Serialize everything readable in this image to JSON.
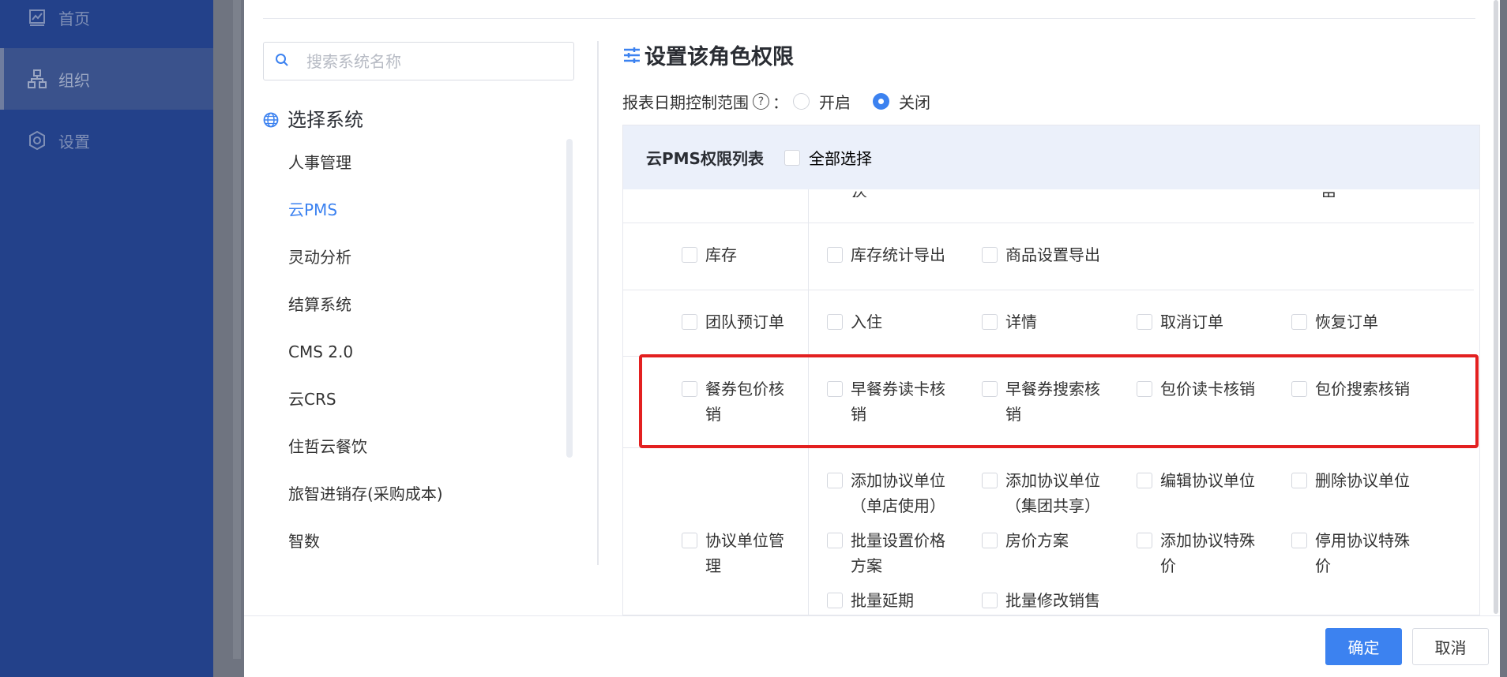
{
  "sidebar": {
    "items": [
      {
        "label": "首页",
        "icon": "chart-icon"
      },
      {
        "label": "组织",
        "icon": "org-icon"
      },
      {
        "label": "设置",
        "icon": "gear-icon"
      }
    ]
  },
  "search": {
    "placeholder": "搜索系统名称"
  },
  "systems": {
    "title": "选择系统",
    "items": [
      "人事管理",
      "云PMS",
      "灵动分析",
      "结算系统",
      "CMS 2.0",
      "云CRS",
      "住哲云餐饮",
      "旅智进销存(采购成本)",
      "智数"
    ],
    "selected": "云PMS"
  },
  "permissions": {
    "title": "设置该角色权限",
    "date_control_label": "报表日期控制范围",
    "date_control_colon": "：",
    "date_control_help": "?",
    "options": [
      "开启",
      "关闭"
    ],
    "selected_option": "关闭",
    "table_title": "云PMS权限列表",
    "select_all": "全部选择",
    "cut_top": [
      "价",
      "用"
    ],
    "rows": [
      {
        "module": "库存",
        "perms": [
          "库存统计导出",
          "商品设置导出"
        ]
      },
      {
        "module": "团队预订单",
        "perms": [
          "入住",
          "详情",
          "取消订单",
          "恢复订单"
        ]
      },
      {
        "module": "餐券包价核销",
        "perms": [
          "早餐券读卡核销",
          "早餐券搜索核销",
          "包价读卡核销",
          "包价搜索核销"
        ]
      },
      {
        "module": "协议单位管理",
        "perms": [
          "添加协议单位（单店使用）",
          "添加协议单位（集团共享）",
          "编辑协议单位",
          "删除协议单位",
          "批量设置价格方案",
          "房价方案",
          "添加协议特殊价",
          "停用协议特殊价",
          "批量延期",
          "批量修改销售"
        ]
      }
    ]
  },
  "footer": {
    "ok": "确定",
    "cancel": "取消"
  },
  "colors": {
    "sidebar": "#23418a",
    "primary": "#3c82f0",
    "highlight": "#e32020",
    "table_header": "#ebf0fa"
  }
}
